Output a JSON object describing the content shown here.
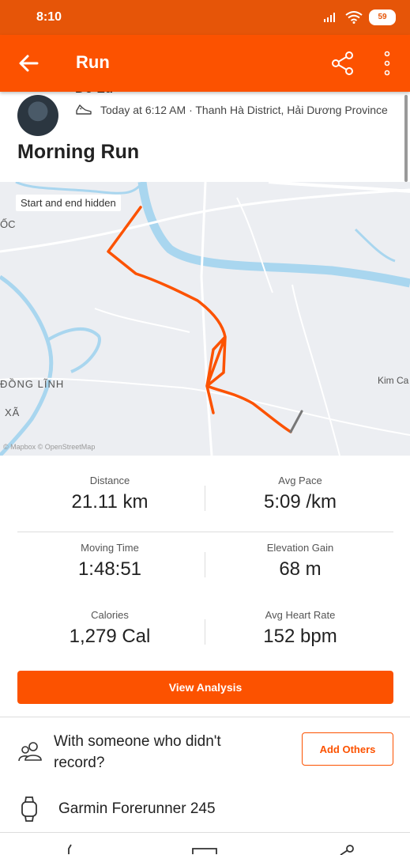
{
  "status_bar": {
    "time": "8:10",
    "battery": "59"
  },
  "app_bar": {
    "title": "Run",
    "icons": [
      "back-arrow-icon",
      "share-icon",
      "more-vert-icon"
    ]
  },
  "header": {
    "athlete_name": "Đỗ Lữ",
    "meta": "Today at 6:12 AM · Thanh Hà District, Hải Dương Province",
    "activity_title": "Morning Run"
  },
  "map": {
    "badge": "Start and end hidden",
    "labels": {
      "top_left": "ỐC",
      "mid_left": "ĐỒNG LĨNH",
      "lower_left": "XÃ",
      "right": "Kim Ca"
    },
    "attribution": "© Mapbox © OpenStreetMap",
    "route_color": "#fc5200"
  },
  "stats": [
    {
      "label": "Distance",
      "value": "21.11 km"
    },
    {
      "label": "Avg Pace",
      "value": "5:09 /km"
    },
    {
      "label": "Moving Time",
      "value": "1:48:51"
    },
    {
      "label": "Elevation Gain",
      "value": "68 m"
    },
    {
      "label": "Calories",
      "value": "1,279 Cal"
    },
    {
      "label": "Avg Heart Rate",
      "value": "152 bpm"
    }
  ],
  "actions": {
    "view_analysis": "View Analysis",
    "add_others": "Add Others"
  },
  "with_someone": "With someone who didn't record?",
  "device": "Garmin Forerunner 245",
  "colors": {
    "accent": "#fc5200",
    "status": "#e65508"
  }
}
